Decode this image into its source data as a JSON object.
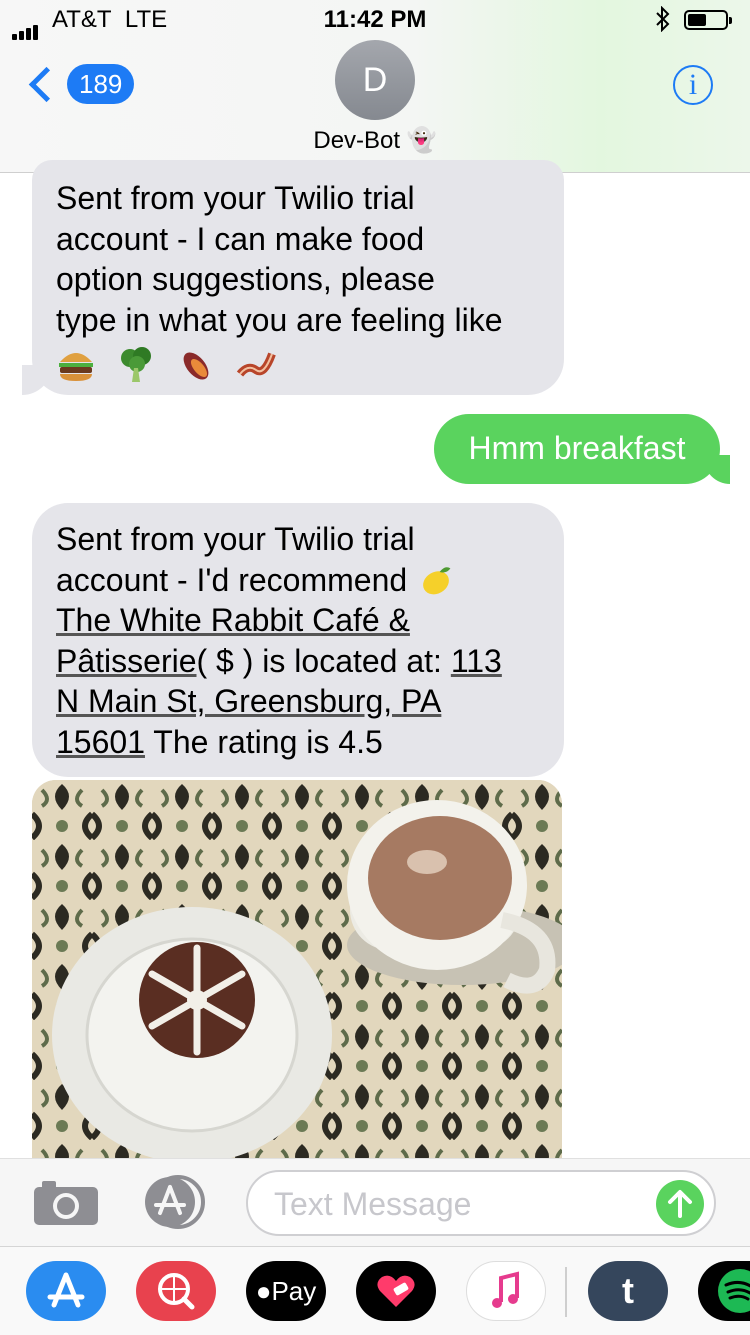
{
  "status_bar": {
    "carrier": "AT&T",
    "network": "LTE",
    "time": "11:42 PM"
  },
  "header": {
    "back_count": "189",
    "avatar_initial": "D",
    "contact_name": "Dev-Bot 👻",
    "info_label": "i"
  },
  "messages": [
    {
      "direction": "incoming",
      "lines": [
        "Sent from your Twilio trial",
        "account - I can make food",
        "option suggestions, please",
        "type in what you are feeling like"
      ],
      "emojis": [
        "burger-emoji",
        "broccoli-emoji",
        "sweet-potato-emoji",
        "bacon-emoji"
      ]
    },
    {
      "direction": "outgoing",
      "text": "Hmm breakfast"
    },
    {
      "direction": "incoming",
      "segments": {
        "l1": "Sent from your Twilio trial",
        "l2a": "account - I'd recommend ",
        "l3": "The White Rabbit Café &",
        "l4a": "Pâtisserie",
        "l4b": "( $ ) is located at: ",
        "l4c": "113",
        "l5": "N Main St, Greensburg, PA",
        "l6a": "15601",
        "l6b": " The rating is 4.5"
      },
      "emoji": "lemon-emoji"
    }
  ],
  "composer": {
    "placeholder": "Text Message"
  },
  "app_drawer": {
    "apps": [
      "app-store",
      "search-images",
      "apple-pay",
      "digital-touch",
      "music",
      "tumblr",
      "spotify"
    ],
    "apple_pay_label": "Pay"
  },
  "colors": {
    "imessage_blue": "#1d7bf5",
    "sms_green": "#5ad35e",
    "incoming_gray": "#e5e5ea"
  }
}
